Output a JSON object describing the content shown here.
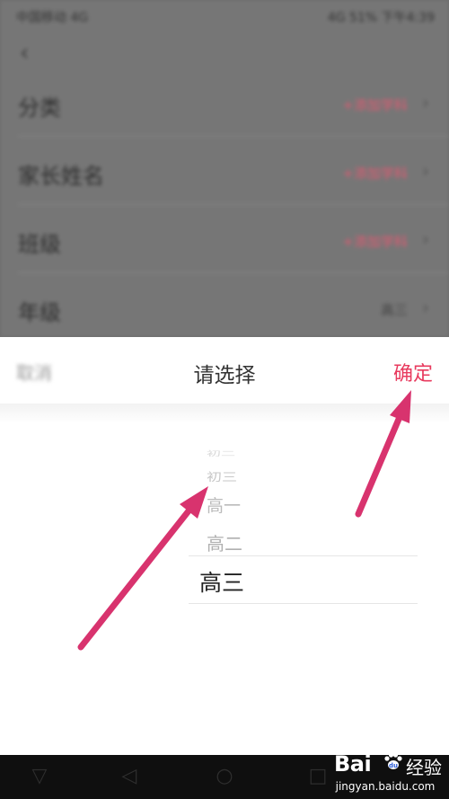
{
  "background_screen": {
    "status_left": "中国移动 4G",
    "status_right": "4G 51% 下午4:39",
    "back_icon": "chevron-left-icon",
    "rows": [
      {
        "label": "分类",
        "value": "+添加学科",
        "value_color": "#e05a72"
      },
      {
        "label": "家长姓名",
        "value": "+添加学科",
        "value_color": "#e05a72"
      },
      {
        "label": "班级",
        "value": "+添加学科",
        "value_color": "#e05a72"
      },
      {
        "label": "年级",
        "value": "高三",
        "value_color": "#444444"
      }
    ]
  },
  "picker_sheet": {
    "cancel_label": "取消",
    "title": "请选择",
    "confirm_label": "确定",
    "confirm_color": "#e83a5e",
    "options": [
      "初二",
      "初三",
      "高一",
      "高二",
      "高三"
    ],
    "selected": "高三"
  },
  "navbar": {
    "buttons": [
      "back-icon",
      "home-icon",
      "recent-apps-icon",
      "menu-icon"
    ]
  },
  "watermark": {
    "brand": "Bai",
    "product": "经验",
    "url": "jingyan.baidu.com"
  },
  "annotation_color": "#d8336e"
}
